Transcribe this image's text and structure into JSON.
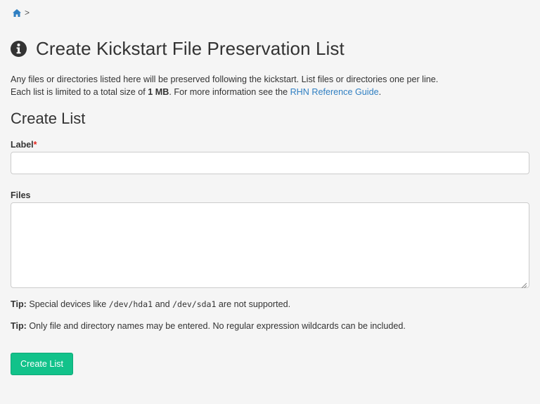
{
  "breadcrumb": {
    "icon": "home-icon",
    "separator": ">"
  },
  "header": {
    "icon": "info-circle-icon",
    "title": "Create Kickstart File Preservation List"
  },
  "intro": {
    "line1": "Any files or directories listed here will be preserved following the kickstart. List files or directories one per line.",
    "line2_prefix": "Each list is limited to a total size of ",
    "line2_bold": "1 MB",
    "line2_middle": ". For more information see the ",
    "link": "RHN Reference Guide",
    "line2_suffix": "."
  },
  "section": {
    "title": "Create List"
  },
  "form": {
    "label_field": {
      "label": "Label",
      "required_mark": "*",
      "value": ""
    },
    "files_field": {
      "label": "Files",
      "value": ""
    }
  },
  "tips": [
    {
      "prefix": "Tip:",
      "text_a": "Special devices like ",
      "code_a": "/dev/hda1",
      "text_b": " and ",
      "code_b": "/dev/sda1",
      "text_c": " are not supported."
    },
    {
      "prefix": "Tip:",
      "text": "Only file and directory names may be entered. No regular expression wildcards can be included."
    }
  ],
  "submit": {
    "label": "Create List"
  },
  "colors": {
    "accent": "#12c28a",
    "link": "#2f7fc2",
    "required": "#e5261f",
    "background": "#f5f5f5"
  }
}
